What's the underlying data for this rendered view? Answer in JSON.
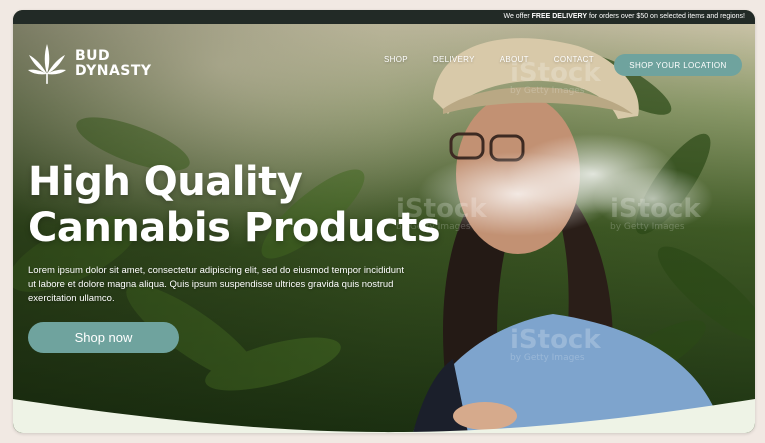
{
  "promo": {
    "prefix": "We offer",
    "highlight": "FREE DELIVERY",
    "suffix": "for orders over $50 on selected items and regions!"
  },
  "brand": {
    "line1": "BUD",
    "line2": "DYNASTY"
  },
  "nav": {
    "items": [
      {
        "label": "SHOP"
      },
      {
        "label": "DELIVERY"
      },
      {
        "label": "ABOUT"
      },
      {
        "label": "CONTACT"
      }
    ],
    "cta": "SHOP YOUR LOCATION"
  },
  "hero": {
    "headline_line1": "High Quality",
    "headline_line2": "Cannabis Products",
    "body": "Lorem ipsum dolor sit amet, consectetur adipiscing elit, sed do eiusmod tempor incididunt ut labore et dolore magna aliqua. Quis ipsum suspendisse ultrices gravida quis nostrud exercitation ullamco.",
    "cta": "Shop now"
  },
  "watermark": {
    "mark": "iStock",
    "credit": "by Getty Images"
  },
  "colors": {
    "accent": "#6fa39e",
    "topbar": "#222a26",
    "page_background": "#f1e9e3",
    "wave": "#eef3e6"
  },
  "icons": {
    "logo": "cannabis-leaf-icon"
  }
}
